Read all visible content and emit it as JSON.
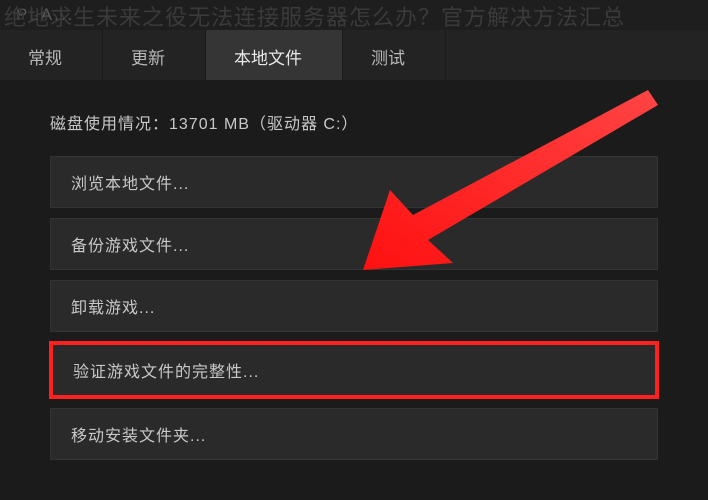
{
  "overlay": {
    "title": "绝地求生未来之役无法连接服务器怎么办？官方解决方法汇总"
  },
  "window": {
    "topbar_label": "PLA..."
  },
  "tabs": {
    "items": [
      {
        "label": "常规",
        "active": false
      },
      {
        "label": "更新",
        "active": false
      },
      {
        "label": "本地文件",
        "active": true
      },
      {
        "label": "测试",
        "active": false
      }
    ]
  },
  "content": {
    "disk_usage": "磁盘使用情况：13701 MB（驱动器 C:）",
    "options": [
      {
        "label": "浏览本地文件...",
        "highlighted": false
      },
      {
        "label": "备份游戏文件...",
        "highlighted": false
      },
      {
        "label": "卸载游戏...",
        "highlighted": false
      },
      {
        "label": "验证游戏文件的完整性...",
        "highlighted": true
      },
      {
        "label": "移动安装文件夹...",
        "highlighted": false
      }
    ]
  }
}
